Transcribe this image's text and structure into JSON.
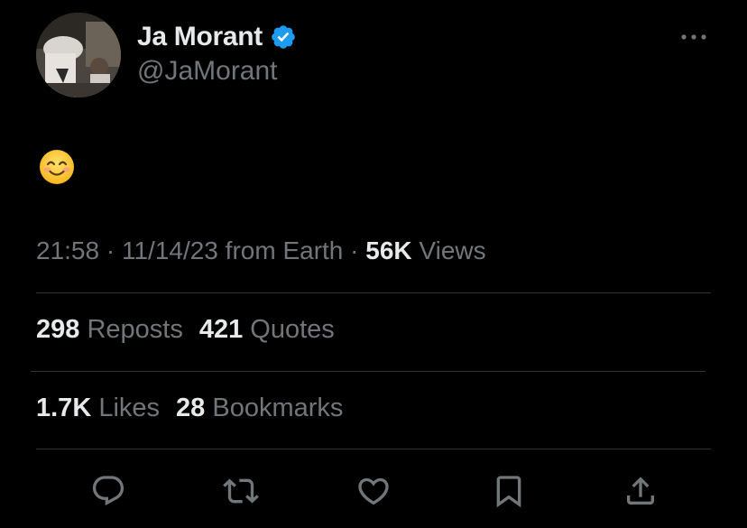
{
  "author": {
    "display_name": "Ja Morant",
    "handle": "@JaMorant",
    "verified": true,
    "verified_color": "#1d9bf0"
  },
  "tweet": {
    "emoji": "smiling-face-with-smiling-eyes",
    "time": "21:58",
    "date": "11/14/23",
    "source": "from Earth",
    "views_count": "56K",
    "views_label": "Views",
    "sep": "·"
  },
  "stats": {
    "reposts_count": "298",
    "reposts_label": "Reposts",
    "quotes_count": "421",
    "quotes_label": "Quotes",
    "likes_count": "1.7K",
    "likes_label": "Likes",
    "bookmarks_count": "28",
    "bookmarks_label": "Bookmarks"
  },
  "actions": [
    "reply-icon",
    "repost-icon",
    "like-icon",
    "bookmark-icon",
    "share-icon"
  ],
  "colors": {
    "background": "#000000",
    "text_primary": "#e7e9ea",
    "text_secondary": "#71767b",
    "divider": "#2f3336"
  }
}
